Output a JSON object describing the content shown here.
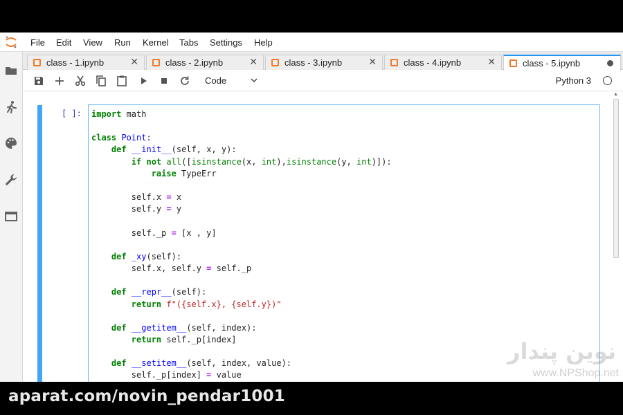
{
  "menubar": {
    "items": [
      "File",
      "Edit",
      "View",
      "Run",
      "Kernel",
      "Tabs",
      "Settings",
      "Help"
    ]
  },
  "tabs": [
    {
      "label": "class - 1.ipynb",
      "active": false
    },
    {
      "label": "class - 2.ipynb",
      "active": false
    },
    {
      "label": "class - 3.ipynb",
      "active": false
    },
    {
      "label": "class - 4.ipynb",
      "active": false
    },
    {
      "label": "class - 5.ipynb",
      "active": true
    }
  ],
  "tab_close_glyph": "✕",
  "toolbar": {
    "icons": [
      "save-icon",
      "add-cell-icon",
      "cut-icon",
      "copy-icon",
      "paste-icon",
      "run-icon",
      "stop-icon",
      "restart-icon"
    ],
    "cell_type": "Code",
    "kernel": "Python 3"
  },
  "cell": {
    "prompt": "[ ]:",
    "code": [
      "import math",
      "",
      "class Point:",
      "    def __init__(self, x, y):",
      "        if not all([isinstance(x, int),isinstance(y, int)]):",
      "            raise TypeErr",
      "",
      "        self.x = x",
      "        self.y = y",
      "",
      "        self._p = [x , y]",
      "",
      "    def _xy(self):",
      "        self.x, self.y = self._p",
      "",
      "    def __repr__(self):",
      "        return f\"({self.x}, {self.y})\"",
      "",
      "    def __getitem__(self, index):",
      "        return self._p[index]",
      "",
      "    def __setitem__(self, index, value):",
      "        self._p[index] = value"
    ]
  },
  "watermark": {
    "logo": "نوین پندار",
    "site": "www.NPShop.net"
  },
  "caption": "aparat.com/novin_pendar1001",
  "colors": {
    "accent": "#2196f3",
    "cell_bar": "#42a5f5",
    "notebook_icon": "#f37726"
  }
}
